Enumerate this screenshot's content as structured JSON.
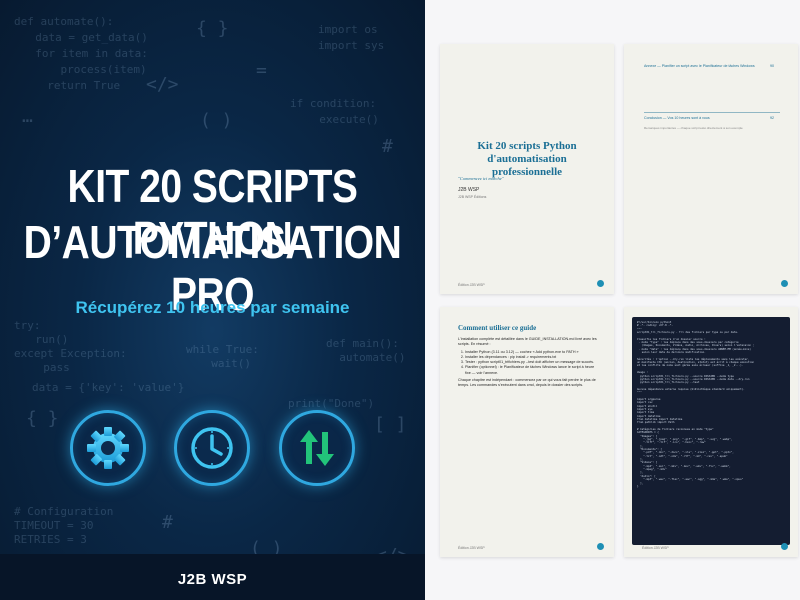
{
  "cover": {
    "title_line1": "KIT 20 SCRIPTS PYTHON",
    "title_line2": "D’AUTOMATISATION PRO",
    "subtitle": "Récupérez 10 heures par semaine",
    "brand": "J2B WSP",
    "accent_color": "#3fc4f0",
    "icons": [
      "gear-icon",
      "clock-icon",
      "up-down-arrows-icon"
    ],
    "bg_code": [
      "def automate():",
      "  data = get_data()",
      "  for item in data:",
      "    process(item)",
      "  return True",
      "import os",
      "import sys",
      "if condition:",
      "  execute()",
      "try:",
      "  run()",
      "except Exception:",
      "  pass",
      "while True:",
      "  wait()",
      "def main():",
      "  automate()",
      "data = {'key': 'value'}",
      "print(\"Done\")",
      "# Configuration",
      "TIMEOUT = 30",
      "RETRIES = 3"
    ]
  },
  "pages": {
    "title_page": {
      "title": "Kit 20 scripts Python d'automatisation professionnelle",
      "quote": "\"Commencez ici marche\"",
      "author": "J2B WSP",
      "editions": "J2B WSP Éditions",
      "footer": "Édition J2B WSP"
    },
    "toc_page": {
      "entry1": "Annexe — Planifier un script avec le Planificateur de tâches Windows",
      "entry1_page": "90",
      "entry2": "Conclusion — Vos 10 heures sont à vous",
      "entry2_page": "92",
      "note": "Remarques importantes — chaque script testé directement à son exemple"
    },
    "guide_page": {
      "heading": "Comment utiliser ce guide",
      "intro": "L'installation complète est détaillée dans le GUIDE_INSTALLATION.md livré avec les scripts. En résumé :",
      "steps": [
        "Installer Python (3.11 ou 3.12) — cochez « Add python.exe to PATH »",
        "Installer les dépendances : pip install -r requirements.txt",
        "Tester : python script01_trifichiers.py --test doit afficher un message de succès.",
        "Planifier (optionnel) : le Planificateur de tâches Windows lance le script à heure fixe — voir l'annexe."
      ],
      "outro": "Chaque chapitre est indépendant : commencez par ce qui vous fait perdre le plus de temps. Les commandes s'exécutent dans cmd, depuis le dossier des scripts.",
      "footer": "Édition J2B WSP"
    },
    "code_page": {
      "code": "#!/usr/bin/env python3\n# -*- coding: utf-8 -*-\n\"\"\"\nscript01_tri_fichiers.py - Tri des fichiers par type ou par date.\n\nClassifie les fichiers d'un dossier source :\n - mode \"type\" : les déplace dans des sous-dossiers par catégorie\n   (Images, Documents, Vidéos, Audio, Archives, Divers) selon l'extension ;\n - mode \"date\" : les déplace dans des sous-dossiers ANNÉE-MM (année-mois)\n   selon leur date de dernière modification.\n\nSécurités : l'option --dry-run liste les déplacements sans les exécuter,\nun manifeste CSV (ancien, destination, statut) est écrit à chaque exécution\net les conflits de noms sont gérés sans écraser (suffixe _1, _2...).\n\nUsage :\n  python script01_tri_fichiers.py --source DOSSIER --mode type\n  python script01_tri_fichiers.py --source DOSSIER --mode date --dry-run\n  python script01_tri_fichiers.py --test\n\nAucune dépendance externe requise (bibliothèque standard uniquement).\n\"\"\"\n\nimport argparse\nimport csv\nimport shutil\nimport sys\nimport time\nimport datetime\nfrom datetime import datetime\nfrom pathlib import Path\n\n# Catégories de fichiers reconnues en mode \"type\"\nCATEGORIES = {\n  \"Images\": [\n    \".jpg\", \".jpeg\", \".png\", \".gif\", \".bmp\", \".svg\", \".webp\",\n    \".tiff\", \".tif\", \".ico\", \".heic\", \".raw\"\n  ],\n  \"Documents\": [\n    \".pdf\", \".doc\", \".docx\", \".xls\", \".xlsx\", \".ppt\", \".pptx\",\n    \".txt\", \".odt\", \".ods\", \".rtf\", \".md\", \".csv\", \".epub\"\n  ],\n  \"Videos\": [\n    \".mp4\", \".avi\", \".mkv\", \".mov\", \".wmv\", \".flv\", \".webm\",\n    \".mpeg\", \".m4v\"\n  ],\n  \"Audio\": [\n    \".mp3\", \".wav\", \".flac\", \".aac\", \".ogg\", \".m4a\", \".wma\", \".opus\"\n  ],\n}",
      "footer": "Édition J2B WSP"
    },
    "dot_color": "#1e8fb4"
  }
}
